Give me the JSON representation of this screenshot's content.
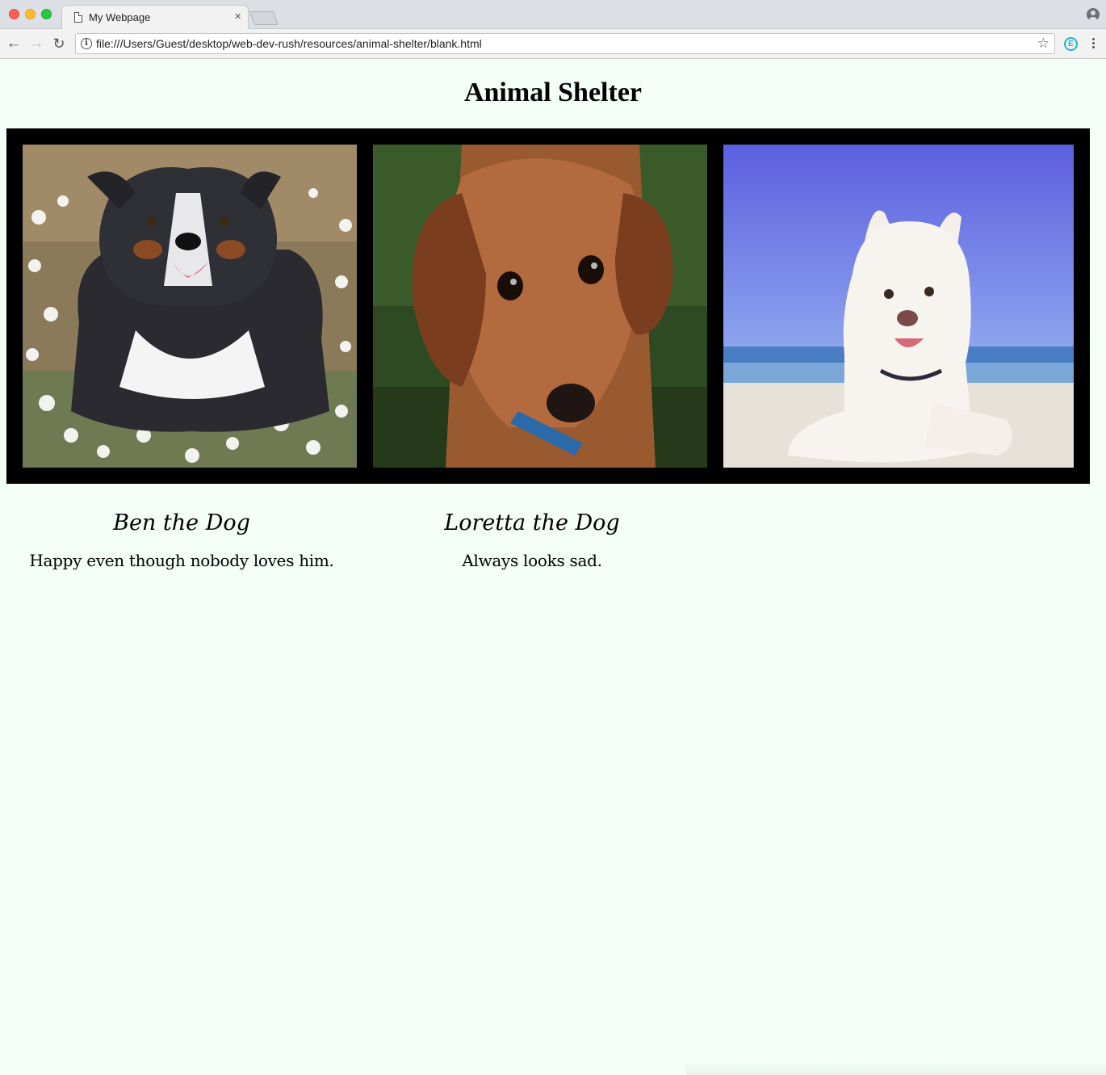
{
  "browser": {
    "tab_title": "My Webpage",
    "tab_close": "×",
    "url": "file:///Users/Guest/desktop/web-dev-rush/resources/animal-shelter/blank.html",
    "extension_letter": "E"
  },
  "page": {
    "title": "Animal Shelter",
    "background_color": "#f4fff8",
    "gallery_border_color": "#000000",
    "pets": [
      {
        "name": "Ben the Dog",
        "description": "Happy even though nobody loves him."
      },
      {
        "name": "Loretta the Dog",
        "description": "Always looks sad."
      }
    ]
  },
  "icons": {
    "back": "arrow-left-icon",
    "forward": "arrow-right-icon",
    "reload": "reload-icon",
    "info": "info-icon",
    "bookmark": "star-icon",
    "menu": "kebab-menu-icon",
    "profile": "profile-icon",
    "tab_page": "document-icon"
  }
}
